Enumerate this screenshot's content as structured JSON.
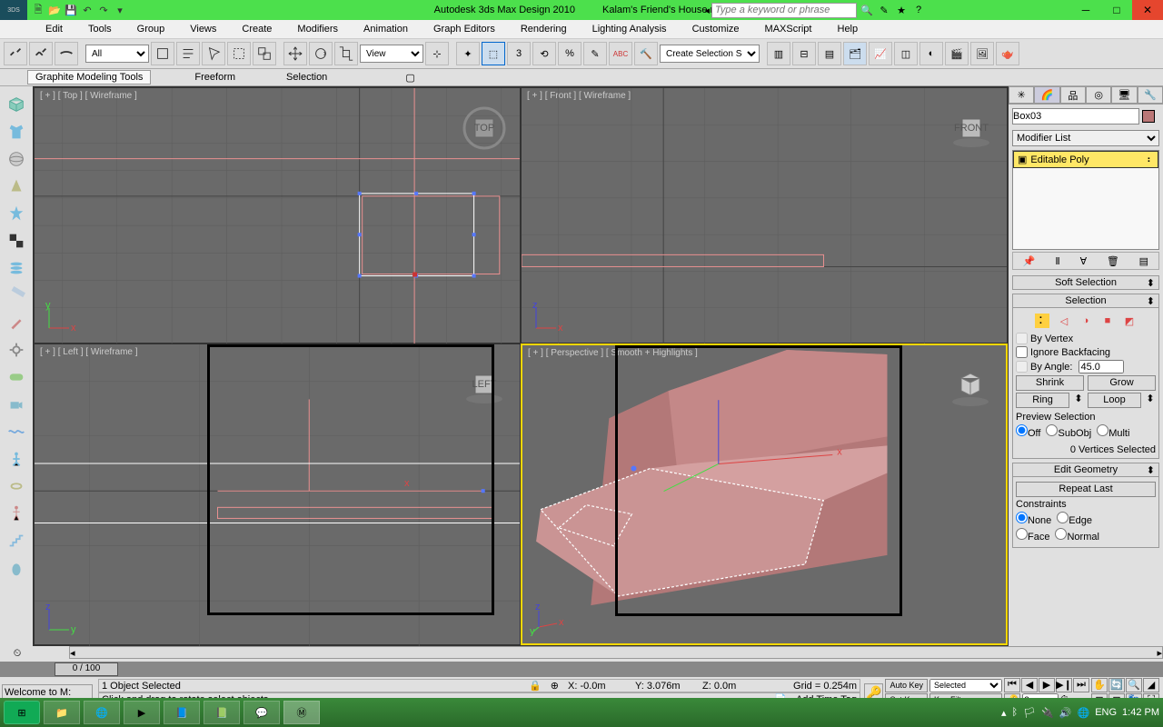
{
  "title": {
    "app": "Autodesk 3ds Max Design 2010",
    "file": "Kalam's Friend's House.max"
  },
  "search_placeholder": "Type a keyword or phrase",
  "menus": [
    "Edit",
    "Tools",
    "Group",
    "Views",
    "Create",
    "Modifiers",
    "Animation",
    "Graph Editors",
    "Rendering",
    "Lighting Analysis",
    "Customize",
    "MAXScript",
    "Help"
  ],
  "toolbar_selects": {
    "all": "All",
    "view": "View",
    "create_set": "Create Selection Se"
  },
  "ribbon": {
    "tabs": [
      "Graphite Modeling Tools",
      "Freeform",
      "Selection"
    ],
    "active": 0
  },
  "viewports": {
    "tl": "[ + ] [ Top ] [ Wireframe ]",
    "tr": "[ + ] [ Front ] [ Wireframe ]",
    "bl": "[ + ] [ Left ] [ Wireframe ]",
    "br": "[ + ] [ Perspective ] [ Smooth + Highlights ]",
    "cube_tl": "TOP",
    "cube_tr": "FRONT",
    "cube_bl": "LEFT"
  },
  "cmdpanel": {
    "object_name": "Box03",
    "modifier_list": "Modifier List",
    "stack_item": "Editable Poly",
    "soft_sel": "Soft Selection",
    "selection": "Selection",
    "by_vertex": "By Vertex",
    "ignore_backfacing": "Ignore Backfacing",
    "by_angle": "By Angle:",
    "angle_val": "45.0",
    "shrink": "Shrink",
    "grow": "Grow",
    "ring": "Ring",
    "loop": "Loop",
    "preview": "Preview Selection",
    "preview_opts": [
      "Off",
      "SubObj",
      "Multi"
    ],
    "sel_status": "0 Vertices Selected",
    "edit_geom": "Edit Geometry",
    "repeat_last": "Repeat Last",
    "constraints": "Constraints",
    "constraint_opts": [
      "None",
      "Edge",
      "Face",
      "Normal"
    ]
  },
  "timeline": {
    "thumb": "0 / 100"
  },
  "status": {
    "welcome": "Welcome to M:",
    "line1": "1 Object Selected",
    "line2": "Click and drag to rotate  select objects",
    "x": "X:  -0.0m",
    "y": "Y:  3.076m",
    "z": "Z:  0.0m",
    "grid": "Grid = 0.254m",
    "autokey": "Auto Key",
    "setkey": "Set Key",
    "selected": "Selected",
    "keyfilters": "Key Filters...",
    "addtag": "Add Time Tag",
    "frame": "0"
  },
  "taskbar": {
    "lang": "ENG",
    "time": "1:42 PM"
  }
}
